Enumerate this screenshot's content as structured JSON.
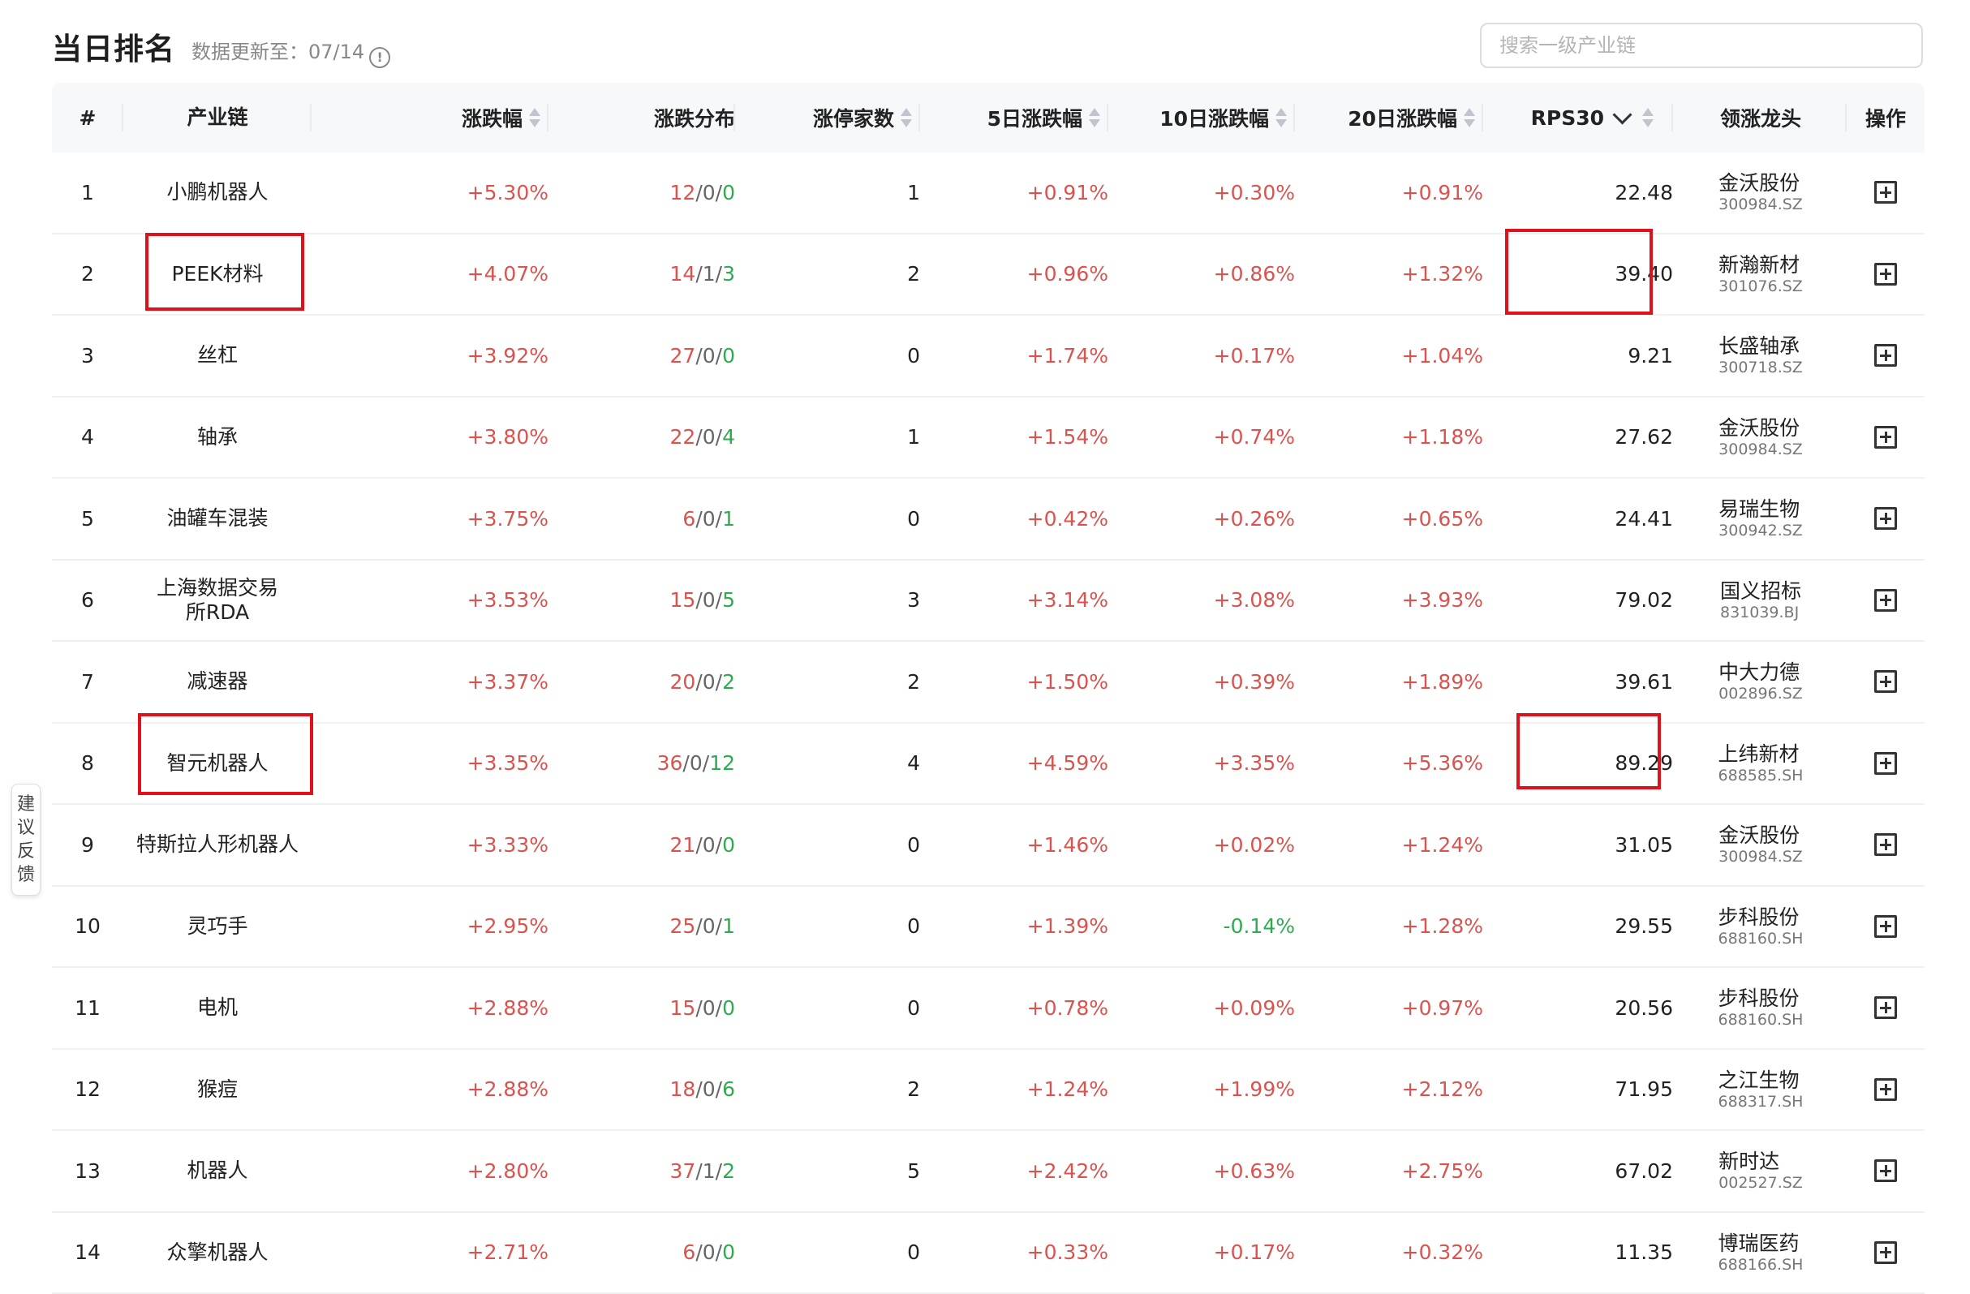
{
  "page": {
    "title": "当日排名",
    "updated_label": "数据更新至：07/14",
    "search_placeholder": "搜索一级产业链",
    "feedback_chars": [
      "建",
      "议",
      "反",
      "馈"
    ]
  },
  "table": {
    "headers": {
      "num": "#",
      "name": "产业链",
      "chg": "涨跌幅",
      "dist": "涨跌分布",
      "limit": "涨停家数",
      "d5": "5日涨跌幅",
      "d10": "10日涨跌幅",
      "d20": "20日涨跌幅",
      "rps": "RPS30",
      "lead": "领涨龙头",
      "op": "操作"
    },
    "rows": [
      {
        "num": "1",
        "name": "小鹏机器人",
        "chg": "+5.30%",
        "dist": [
          "12",
          "0",
          "0"
        ],
        "limit": "1",
        "d5": "+0.91%",
        "d10": "+0.30%",
        "d20": "+0.91%",
        "rps": "22.48",
        "lead_name": "金沃股份",
        "lead_code": "300984.SZ"
      },
      {
        "num": "2",
        "name": "PEEK材料",
        "chg": "+4.07%",
        "dist": [
          "14",
          "1",
          "3"
        ],
        "limit": "2",
        "d5": "+0.96%",
        "d10": "+0.86%",
        "d20": "+1.32%",
        "rps": "39.40",
        "lead_name": "新瀚新材",
        "lead_code": "301076.SZ"
      },
      {
        "num": "3",
        "name": "丝杠",
        "chg": "+3.92%",
        "dist": [
          "27",
          "0",
          "0"
        ],
        "limit": "0",
        "d5": "+1.74%",
        "d10": "+0.17%",
        "d20": "+1.04%",
        "rps": "9.21",
        "lead_name": "长盛轴承",
        "lead_code": "300718.SZ"
      },
      {
        "num": "4",
        "name": "轴承",
        "chg": "+3.80%",
        "dist": [
          "22",
          "0",
          "4"
        ],
        "limit": "1",
        "d5": "+1.54%",
        "d10": "+0.74%",
        "d20": "+1.18%",
        "rps": "27.62",
        "lead_name": "金沃股份",
        "lead_code": "300984.SZ"
      },
      {
        "num": "5",
        "name": "油罐车混装",
        "chg": "+3.75%",
        "dist": [
          "6",
          "0",
          "1"
        ],
        "limit": "0",
        "d5": "+0.42%",
        "d10": "+0.26%",
        "d20": "+0.65%",
        "rps": "24.41",
        "lead_name": "易瑞生物",
        "lead_code": "300942.SZ"
      },
      {
        "num": "6",
        "name": "上海数据交易所RDA",
        "chg": "+3.53%",
        "dist": [
          "15",
          "0",
          "5"
        ],
        "limit": "3",
        "d5": "+3.14%",
        "d10": "+3.08%",
        "d20": "+3.93%",
        "rps": "79.02",
        "lead_name": "国义招标",
        "lead_code": "831039.BJ"
      },
      {
        "num": "7",
        "name": "减速器",
        "chg": "+3.37%",
        "dist": [
          "20",
          "0",
          "2"
        ],
        "limit": "2",
        "d5": "+1.50%",
        "d10": "+0.39%",
        "d20": "+1.89%",
        "rps": "39.61",
        "lead_name": "中大力德",
        "lead_code": "002896.SZ"
      },
      {
        "num": "8",
        "name": "智元机器人",
        "chg": "+3.35%",
        "dist": [
          "36",
          "0",
          "12"
        ],
        "limit": "4",
        "d5": "+4.59%",
        "d10": "+3.35%",
        "d20": "+5.36%",
        "rps": "89.29",
        "lead_name": "上纬新材",
        "lead_code": "688585.SH"
      },
      {
        "num": "9",
        "name": "特斯拉人形机器人",
        "chg": "+3.33%",
        "dist": [
          "21",
          "0",
          "0"
        ],
        "limit": "0",
        "d5": "+1.46%",
        "d10": "+0.02%",
        "d20": "+1.24%",
        "rps": "31.05",
        "lead_name": "金沃股份",
        "lead_code": "300984.SZ"
      },
      {
        "num": "10",
        "name": "灵巧手",
        "chg": "+2.95%",
        "dist": [
          "25",
          "0",
          "1"
        ],
        "limit": "0",
        "d5": "+1.39%",
        "d10": "-0.14%",
        "d20": "+1.28%",
        "rps": "29.55",
        "lead_name": "步科股份",
        "lead_code": "688160.SH"
      },
      {
        "num": "11",
        "name": "电机",
        "chg": "+2.88%",
        "dist": [
          "15",
          "0",
          "0"
        ],
        "limit": "0",
        "d5": "+0.78%",
        "d10": "+0.09%",
        "d20": "+0.97%",
        "rps": "20.56",
        "lead_name": "步科股份",
        "lead_code": "688160.SH"
      },
      {
        "num": "12",
        "name": "猴痘",
        "chg": "+2.88%",
        "dist": [
          "18",
          "0",
          "6"
        ],
        "limit": "2",
        "d5": "+1.24%",
        "d10": "+1.99%",
        "d20": "+2.12%",
        "rps": "71.95",
        "lead_name": "之江生物",
        "lead_code": "688317.SH"
      },
      {
        "num": "13",
        "name": "机器人",
        "chg": "+2.80%",
        "dist": [
          "37",
          "1",
          "2"
        ],
        "limit": "5",
        "d5": "+2.42%",
        "d10": "+0.63%",
        "d20": "+2.75%",
        "rps": "67.02",
        "lead_name": "新时达",
        "lead_code": "002527.SZ"
      },
      {
        "num": "14",
        "name": "众擎机器人",
        "chg": "+2.71%",
        "dist": [
          "6",
          "0",
          "0"
        ],
        "limit": "0",
        "d5": "+0.33%",
        "d10": "+0.17%",
        "d20": "+0.32%",
        "rps": "11.35",
        "lead_name": "博瑞医药",
        "lead_code": "688166.SH"
      }
    ]
  },
  "colors": {
    "up": "#d9534f",
    "down": "#2eab4f",
    "highlight": "#e0111a"
  }
}
